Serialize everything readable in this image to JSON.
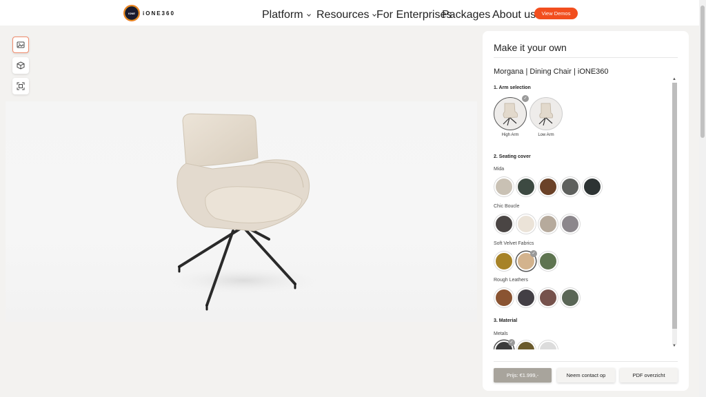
{
  "header": {
    "logo_mark": "IONE",
    "logo_text": "iONE360",
    "nav": [
      {
        "label": "Platform",
        "dropdown": true
      },
      {
        "label": "Resources",
        "dropdown": true
      },
      {
        "label": "For Enterprises",
        "dropdown": false
      },
      {
        "label": "Packages",
        "dropdown": false
      },
      {
        "label": "About us",
        "dropdown": false
      }
    ],
    "cta_label": "View Demos",
    "cta_color": "#f24e1e"
  },
  "tools": [
    {
      "icon": "image-view-icon",
      "active": true
    },
    {
      "icon": "3d-cube-icon",
      "active": false
    },
    {
      "icon": "ar-scan-icon",
      "active": false
    }
  ],
  "configurator": {
    "title": "Make it your own",
    "product_name": "Morgana | Dining Chair | iONE360",
    "sections": {
      "arm": {
        "heading": "1. Arm selection",
        "options": [
          {
            "label": "High Arm",
            "selected": true
          },
          {
            "label": "Low Arm",
            "selected": false
          }
        ]
      },
      "cover": {
        "heading": "2. Seating cover",
        "groups": [
          {
            "name": "Mida",
            "swatches": [
              "#c9c1b4",
              "#3d4a42",
              "#6b4228",
              "#5e605d",
              "#2d3333"
            ],
            "selected": -1
          },
          {
            "name": "Chic Boucle",
            "swatches": [
              "#4a4544",
              "#ebe3d8",
              "#b6aa9c",
              "#8c878c"
            ],
            "selected": -1
          },
          {
            "name": "Soft Velvet Fabrics",
            "swatches": [
              "#a78328",
              "#d3b38d",
              "#5e7450"
            ],
            "selected": 1
          },
          {
            "name": "Rough Leathers",
            "swatches": [
              "#8a5432",
              "#433f45",
              "#76524c",
              "#5a6656"
            ],
            "selected": -1
          }
        ]
      },
      "material": {
        "heading": "3. Material",
        "groups": [
          {
            "name": "Metals",
            "swatches": [
              "#3b3b3b",
              "#6a5a2c",
              "#dcdcdc"
            ],
            "selected": 0
          }
        ]
      }
    },
    "footer": {
      "price": "Prijs: €1.999,-",
      "contact": "Neem contact op",
      "pdf": "PDF overzicht"
    }
  }
}
